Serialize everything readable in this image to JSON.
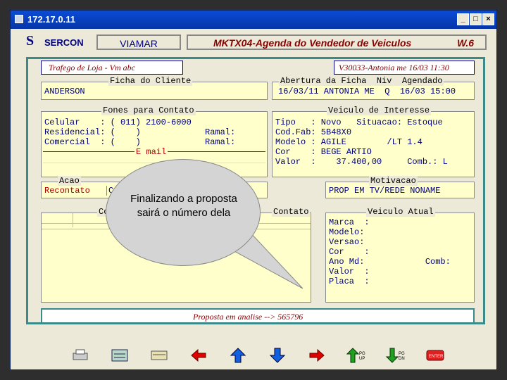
{
  "window": {
    "title": "172.17.0.11"
  },
  "header": {
    "logo_letter": "S",
    "logo_text": "SERCON",
    "module": "VIAMAR",
    "screen_title": "MKTX04-Agenda do Vendedor de Veiculos",
    "version": "W.6"
  },
  "top": {
    "left_label": "Trafego de Loja - Vm abc",
    "right_label": "V30033-Antonia me 16/03 11:30"
  },
  "ficha": {
    "legend": "Ficha do Cliente",
    "name": "ANDERSON"
  },
  "abertura": {
    "legend": "Abertura da Ficha  Niv  Agendado",
    "value": "16/03/11 ANTONIA ME  Q  16/03 15:00"
  },
  "fones": {
    "legend": "Fones para Contato",
    "celular": "Celular    : ( 011) 2100-6000",
    "residencial": "Residencial: (    )",
    "comercial": "Comercial  : (    )",
    "ramal1": "Ramal:",
    "ramal2": "Ramal:",
    "email": "E mail"
  },
  "veiculo_interesse": {
    "legend": "Veiculo de Interesse",
    "tipo": "Tipo   : Novo   Situacao: Estoque",
    "codfab": "Cod.Fab: 5B48X0",
    "modelo": "Modelo : AGILE        /LT 1.4",
    "cor": "Cor    : BEGE ARTIO",
    "valor": "Valor  :    37.400,00     Comb.: L"
  },
  "acao": {
    "legend": "Acao",
    "value": "Recontato",
    "partial": "C"
  },
  "motivacao": {
    "legend": "Motivacao",
    "value": "PROP EM TV/REDE NONAME"
  },
  "contato": {
    "legend_left": "Co",
    "legend_right": "Contato"
  },
  "veiculo_atual": {
    "legend": "Veiculo Atual",
    "marca": "Marca  :",
    "modelo": "Modelo:",
    "versao": "Versao:",
    "cor": "Cor    :",
    "ano": "Ano Md:            Comb:",
    "valor": "Valor  :",
    "placa": "Placa  :"
  },
  "status": {
    "text": "Proposta em analise --> 565796"
  },
  "bubble": {
    "text": "Finalizando a proposta sairá o número dela"
  },
  "colors": {
    "title": "#0a4bd6",
    "teal_border": "#3a8a8a",
    "field_bg": "#ffffcc"
  }
}
